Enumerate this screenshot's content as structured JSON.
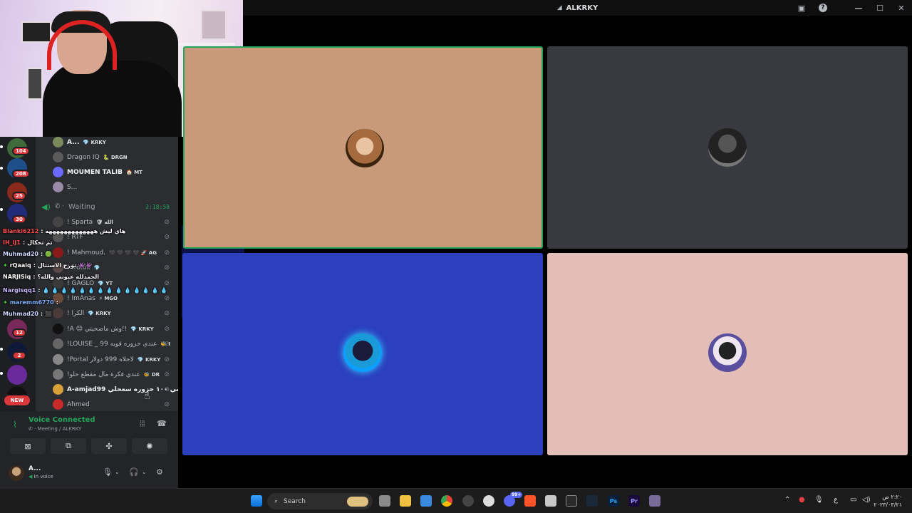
{
  "window": {
    "title": "ALKRKY"
  },
  "voice_users": [
    {
      "name": "A...",
      "tag": "💎 KRKY",
      "bright": true,
      "color": "#7a8a5a"
    },
    {
      "name": "Dragon IQ",
      "tag": "🐍 DRGN",
      "bright": false,
      "color": "#5a5a5a"
    },
    {
      "name": "MOUMEN TALIB",
      "tag": "🏠 MT",
      "bright": true,
      "color": "#6a6aff"
    },
    {
      "name": "S...",
      "tag": "",
      "bright": false,
      "color": "#9a8aa8"
    }
  ],
  "waiting": {
    "label": "Waiting",
    "timer": "2:18:58"
  },
  "muted_users": [
    {
      "name": "! Sparta",
      "tag": "🛡 الله",
      "color": "#444"
    },
    {
      "name": "! RTF",
      "tag": "",
      "color": "#555"
    },
    {
      "name": "! Mahmoud.",
      "tag": "🖤 🖤 🖤 🖤  🚀 AG",
      "color": "#8a1a1a"
    },
    {
      "name": "! frotox",
      "tag": "💎",
      "color": "#5a4a4a"
    },
    {
      "name": "! GAGLO",
      "tag": "💎 YT",
      "color": "#3a3a3a"
    },
    {
      "name": "! ImAnas",
      "tag": "⚡ MGO",
      "color": "#6a4a3a"
    },
    {
      "name": "! الكرا",
      "tag": "💎 KRKY",
      "color": "#4a3a3a"
    },
    {
      "name": "!A 😊 وش ماصحيتي!!",
      "tag": "💎 KRKY",
      "color": "#111"
    },
    {
      "name": "!LOUISE _ 99 عندي حزوره قويه",
      "tag": "🐝 I",
      "color": "#666"
    },
    {
      "name": "!Portal لأحلاه 999 دولار",
      "tag": "💎 KRKY",
      "color": "#888"
    },
    {
      "name": "!عندي فكرة مال مقطع حلو",
      "tag": "🐝 DR",
      "color": "#777"
    },
    {
      "name": "A-amjad99 سي ١٠٠ حزوره سعحلي",
      "tag": "",
      "color": "#d9a03a"
    },
    {
      "name": "Ahmed",
      "tag": "",
      "color": "#c92a2a"
    }
  ],
  "chat": [
    {
      "user": "Blanki6212",
      "user_color": "#ff4f4f",
      "text": "هاي ليش هههههههههههههه"
    },
    {
      "user": "IH_lJ1",
      "user_color": "#ff4f4f",
      "text": "تم تحكال"
    },
    {
      "user": "Muhmad20",
      "user_color": "#cfd6ff",
      "text": "🟢"
    },
    {
      "user": "rQaaiq",
      "user_color": "#ffffff",
      "text": "تورج الاستتال 👾👾"
    },
    {
      "user": "NARJISiq",
      "user_color": "#ffffff",
      "text": "الحمدلله عيوني والله؟"
    },
    {
      "user": "Nargisqq1",
      "user_color": "#c9b8ff",
      "text": "💧 💧 💧 💧 💧 💧 💧 💧 💧 💧 💧 💧 💧 💧"
    },
    {
      "user": "maremm6770",
      "user_color": "#7fb2ff",
      "text": ""
    },
    {
      "user": "Muhmad20",
      "user_color": "#cfd6ff",
      "text": "⬛"
    }
  ],
  "rail": {
    "badges": [
      "104",
      "208",
      "25",
      "30",
      "12",
      "2"
    ],
    "new_label": "NEW"
  },
  "voice_panel": {
    "status": "Voice Connected",
    "channel": "Meeting / ALKRKY"
  },
  "user_panel": {
    "name": "A...",
    "status": "In voice"
  },
  "tiles": [
    {
      "bg": "#c99a7a",
      "avatar": "#a56a3e",
      "speaking": true
    },
    {
      "bg": "#383a40",
      "avatar": "#222",
      "speaking": false
    },
    {
      "bg": "#2b3fbf",
      "avatar": "#1a9ad6",
      "speaking": false
    },
    {
      "bg": "#e3bdb7",
      "avatar": "#5a4e9e",
      "speaking": false
    }
  ],
  "taskbar": {
    "search_placeholder": "Search",
    "clock_time": "٢:٢٠ ص",
    "clock_date": "٢٠٢٣/٠٣/٢١",
    "notification_count": "99+"
  },
  "colors": {
    "accent_green": "#23a55a",
    "discord_bg": "#313338",
    "rail_bg": "#1e1f22",
    "panel_bg": "#2b2d31"
  }
}
